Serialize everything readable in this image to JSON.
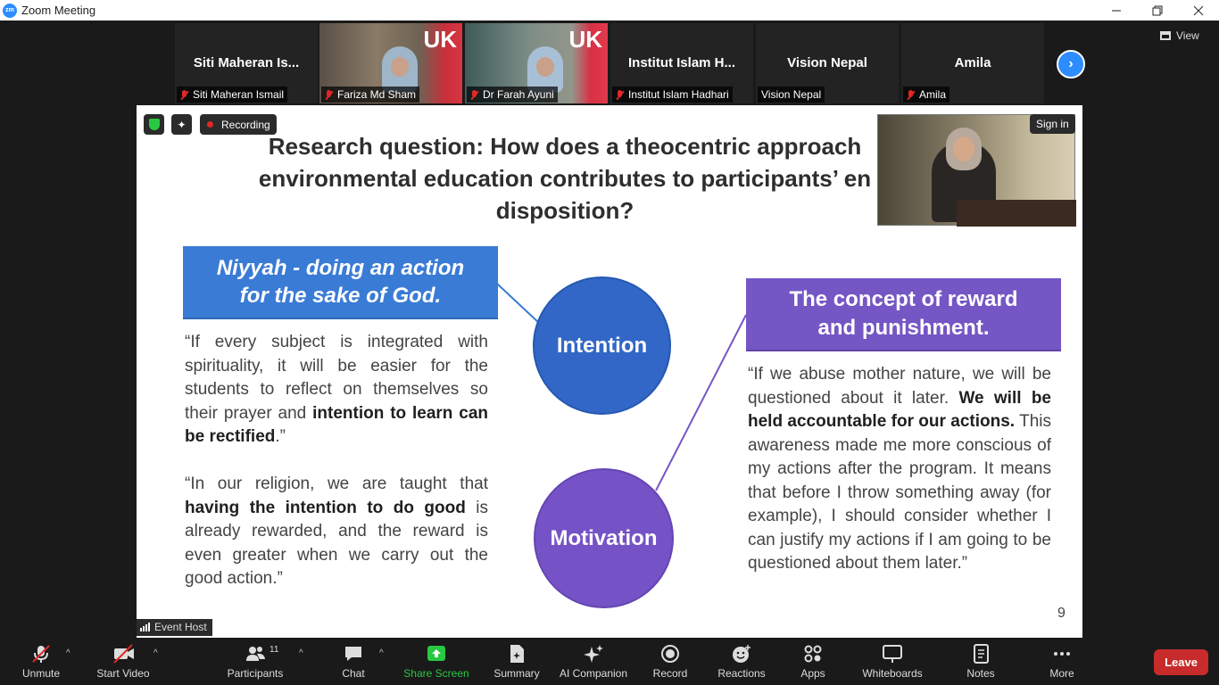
{
  "window": {
    "title": "Zoom Meeting",
    "logo": "zm"
  },
  "gallery": {
    "tiles": [
      {
        "big_name": "Siti Maheran Is...",
        "label": "Siti Maheran Ismail",
        "muted": true
      },
      {
        "big_name": "",
        "label": "Fariza Md Sham",
        "muted": true
      },
      {
        "big_name": "",
        "label": "Dr Farah Ayuni",
        "muted": true
      },
      {
        "big_name": "Institut Islam H...",
        "label": "Institut Islam Hadhari",
        "muted": true
      },
      {
        "big_name": "Vision Nepal",
        "label": "Vision Nepal",
        "muted": false
      },
      {
        "big_name": "Amila",
        "label": "Amila",
        "muted": true
      }
    ],
    "view_label": "View",
    "uk_text": "UK"
  },
  "share": {
    "recording_label": "Recording",
    "sign_in_label": "Sign in",
    "event_host_label": "Event Host"
  },
  "slide": {
    "research_question": "Research question: How does a theocentric approach environmental education contributes to participants’ en disposition?",
    "rq_line1": "Research question: How does a theocentric approach",
    "rq_line2": "environmental education contributes to participants’ en",
    "rq_line3": "disposition?",
    "niyyah_line1": "Niyyah - doing an action",
    "niyyah_line2": "for the sake of God.",
    "intention": "Intention",
    "motivation": "Motivation",
    "concept_line1": "The concept of reward",
    "concept_line2": "and punishment.",
    "q1_a": "“If every subject is integrated with spirituality, it will be easier for the students to reflect on themselves so their prayer and ",
    "q1_b": "intention to learn can be rectified",
    "q1_c": ".”",
    "q2_a": "“In our religion, we are taught that ",
    "q2_b": "having the intention to do good",
    "q2_c": " is already rewarded, and the reward is even greater when we carry out the good action.”",
    "q3_a": "“If we abuse mother nature, we will be questioned about it later. ",
    "q3_b": "We will be held accountable for our actions.",
    "q3_c": " This awareness made me more conscious of my actions after the program. It means that before I throw something away (for example), I should consider whether I can justify my actions if I am going to be questioned about them later.”",
    "page_number": "9"
  },
  "toolbar": {
    "unmute": "Unmute",
    "start_video": "Start Video",
    "participants": "Participants",
    "participants_count": "11",
    "chat": "Chat",
    "share_screen": "Share Screen",
    "summary": "Summary",
    "ai_companion": "AI Companion",
    "record": "Record",
    "reactions": "Reactions",
    "apps": "Apps",
    "whiteboards": "Whiteboards",
    "notes": "Notes",
    "more": "More",
    "leave": "Leave"
  },
  "colors": {
    "accent": "#2d8cff",
    "share_green": "#28c840",
    "leave_red": "#c72b2b",
    "intention_blue": "#3267c7",
    "motivation_purple": "#7553c6"
  }
}
